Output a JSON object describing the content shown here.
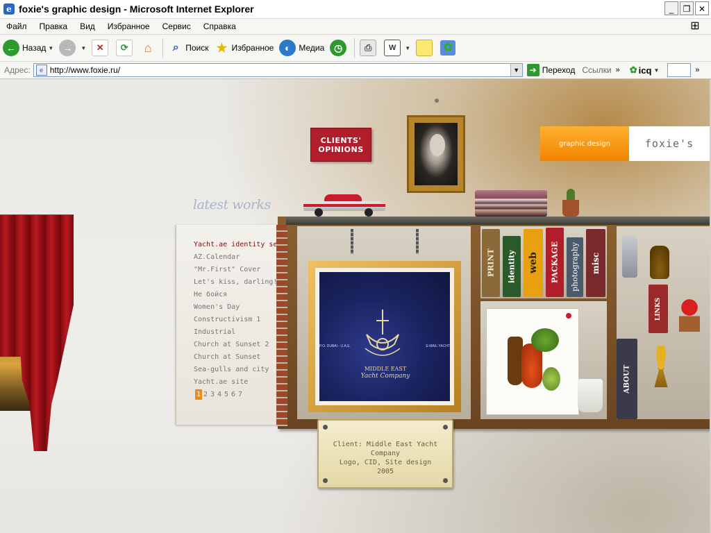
{
  "window": {
    "title": "foxie's graphic design - Microsoft Internet Explorer"
  },
  "menu": [
    "Файл",
    "Правка",
    "Вид",
    "Избранное",
    "Сервис",
    "Справка"
  ],
  "toolbar": {
    "back": "Назад",
    "search": "Поиск",
    "favorites": "Избранное",
    "media": "Медиа"
  },
  "address": {
    "label": "Адрес:",
    "url": "http://www.foxie.ru/",
    "go": "Переход",
    "links": "Ссылки",
    "icq": "icq"
  },
  "site": {
    "clients_line1": "CLIENTS'",
    "clients_line2": "OPINIONS",
    "nav_graphic": "graphic design",
    "nav_logo": "foxie's",
    "latest_title": "latest works",
    "works": [
      "Yacht.ae identity set",
      "AZ.Calendar",
      "\"Mr.First\" Cover",
      "Let's kiss, darling!",
      "Не бойся",
      "Women's Day",
      "Constructivism 1",
      "Industrial",
      "Church at Sunset 2",
      "Church at Sunset",
      "Sea-gulls and city",
      "Yacht.ae site"
    ],
    "pages": [
      "1",
      "2",
      "3",
      "4",
      "5",
      "6",
      "7"
    ],
    "current_page": "1",
    "books": {
      "print": "PRINT",
      "identity": "identity",
      "web": "web",
      "package": "PACKAGE",
      "photography": "photography",
      "misc": "misc",
      "links": "LINKS",
      "about": "ABOUT"
    },
    "artwork": {
      "company_line1": "MIDDLE EAST",
      "company_line2": "Yacht Company",
      "left_text": "P.O. DUBAI - U.A.E.",
      "right_text": "E-MAIL:YACHT"
    },
    "caption": {
      "line1": "Client: Middle East Yacht Company",
      "line2": "Logo, CID, Site design",
      "line3": "2005"
    }
  },
  "colors": {
    "accent_orange": "#f08a10",
    "clients_red": "#b01e2c",
    "active_work": "#7a1010"
  }
}
